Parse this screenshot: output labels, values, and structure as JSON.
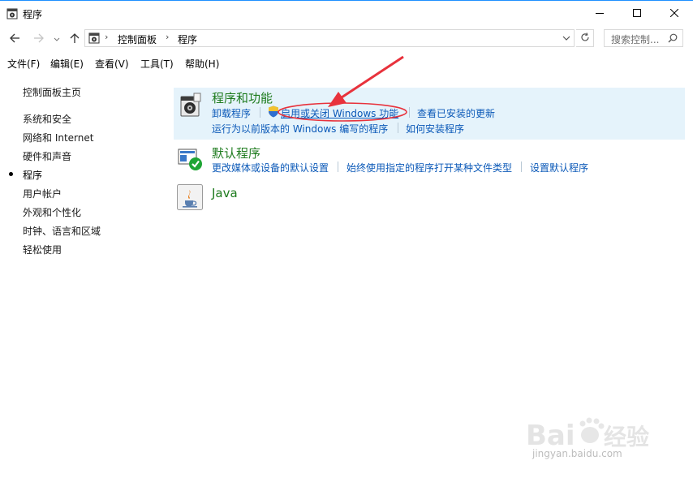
{
  "window": {
    "title": "程序",
    "minimize_icon": "minimize-icon",
    "maximize_icon": "maximize-icon",
    "close_icon": "close-icon"
  },
  "address": {
    "crumbs": [
      "控制面板",
      "程序"
    ],
    "search_placeholder": "搜索控制...",
    "refresh_icon": "refresh-icon"
  },
  "menu": [
    "文件(F)",
    "编辑(E)",
    "查看(V)",
    "工具(T)",
    "帮助(H)"
  ],
  "sidebar": {
    "home": "控制面板主页",
    "items": [
      {
        "label": "系统和安全",
        "selected": false
      },
      {
        "label": "网络和 Internet",
        "selected": false
      },
      {
        "label": "硬件和声音",
        "selected": false
      },
      {
        "label": "程序",
        "selected": true
      },
      {
        "label": "用户帐户",
        "selected": false
      },
      {
        "label": "外观和个性化",
        "selected": false
      },
      {
        "label": "时钟、语言和区域",
        "selected": false
      },
      {
        "label": "轻松使用",
        "selected": false
      }
    ]
  },
  "categories": [
    {
      "title": "程序和功能",
      "icon": "programs-features-icon",
      "links": [
        "卸载程序",
        "启用或关闭 Windows 功能",
        "查看已安装的更新",
        "运行为以前版本的 Windows 编写的程序",
        "如何安装程序"
      ]
    },
    {
      "title": "默认程序",
      "icon": "default-programs-icon",
      "links": [
        "更改媒体或设备的默认设置",
        "始终使用指定的程序打开某种文件类型",
        "设置默认程序"
      ]
    },
    {
      "title": "Java",
      "icon": "java-icon",
      "links": []
    }
  ],
  "colors": {
    "highlight": "#e5f3fb",
    "category_title": "#1e7b1e",
    "link": "#0b59b8",
    "annotation": "#e8323c"
  },
  "watermark": {
    "brand": "Bai 经验",
    "url": "jingyan.baidu.com"
  }
}
